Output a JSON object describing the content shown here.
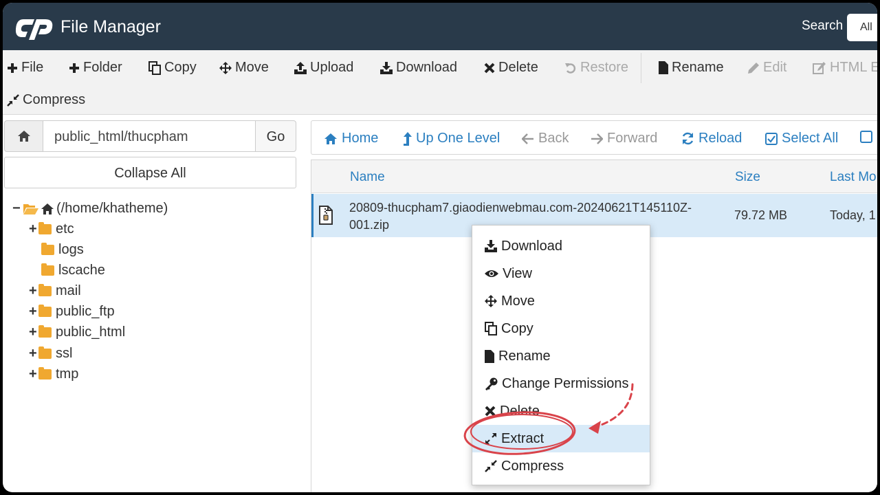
{
  "header": {
    "app_title": "File Manager",
    "search_label": "Search",
    "search_value": "All"
  },
  "toolbar": {
    "row1": [
      {
        "label": "File",
        "icon": "plus-icon",
        "disabled": false
      },
      {
        "label": "Folder",
        "icon": "plus-icon",
        "disabled": false
      },
      {
        "label": "Copy",
        "icon": "copy-icon",
        "disabled": false
      },
      {
        "label": "Move",
        "icon": "move-icon",
        "disabled": false
      },
      {
        "label": "Upload",
        "icon": "upload-icon",
        "disabled": false
      },
      {
        "label": "Download",
        "icon": "download-icon",
        "disabled": false
      },
      {
        "label": "Delete",
        "icon": "close-icon",
        "disabled": false
      },
      {
        "label": "Restore",
        "icon": "undo-icon",
        "disabled": true
      },
      {
        "label": "Rename",
        "icon": "file-icon",
        "disabled": false
      },
      {
        "label": "Edit",
        "icon": "pencil-icon",
        "disabled": true
      },
      {
        "label": "HTML E",
        "icon": "edit-icon",
        "disabled": true
      }
    ],
    "compress_label": "Compress"
  },
  "path_bar": {
    "path_value": "public_html/thucpham",
    "go_label": "Go",
    "collapse_label": "Collapse All"
  },
  "tree": {
    "root_label": "(/home/khatheme)",
    "items": [
      {
        "label": "etc",
        "expandable": true
      },
      {
        "label": "logs",
        "expandable": false
      },
      {
        "label": "lscache",
        "expandable": false
      },
      {
        "label": "mail",
        "expandable": true
      },
      {
        "label": "public_ftp",
        "expandable": true
      },
      {
        "label": "public_html",
        "expandable": true
      },
      {
        "label": "ssl",
        "expandable": true
      },
      {
        "label": "tmp",
        "expandable": true
      }
    ]
  },
  "nav": {
    "home": "Home",
    "up": "Up One Level",
    "back": "Back",
    "forward": "Forward",
    "reload": "Reload",
    "select_all": "Select All"
  },
  "table": {
    "columns": {
      "name": "Name",
      "size": "Size",
      "modified": "Last Mo"
    },
    "rows": [
      {
        "name": "20809-thucpham7.giaodienwebmau.com-20240621T145110Z-001.zip",
        "size": "79.72 MB",
        "modified": "Today, 1"
      }
    ]
  },
  "context_menu": {
    "items": [
      {
        "label": "Download",
        "icon": "download-icon"
      },
      {
        "label": "View",
        "icon": "eye-icon"
      },
      {
        "label": "Move",
        "icon": "move-icon"
      },
      {
        "label": "Copy",
        "icon": "copy-icon"
      },
      {
        "label": "Rename",
        "icon": "file-icon"
      },
      {
        "label": "Change Permissions",
        "icon": "key-icon"
      },
      {
        "label": "Delete",
        "icon": "close-icon"
      },
      {
        "label": "Extract",
        "icon": "expand-icon"
      },
      {
        "label": "Compress",
        "icon": "compress-icon"
      }
    ],
    "highlighted": "Extract"
  },
  "colors": {
    "header_bg": "#293a4a",
    "link_blue": "#2b7fc0",
    "selection_bg": "#d8eaf8",
    "folder_orange": "#f0a830",
    "annotation_red": "#d9434a"
  }
}
